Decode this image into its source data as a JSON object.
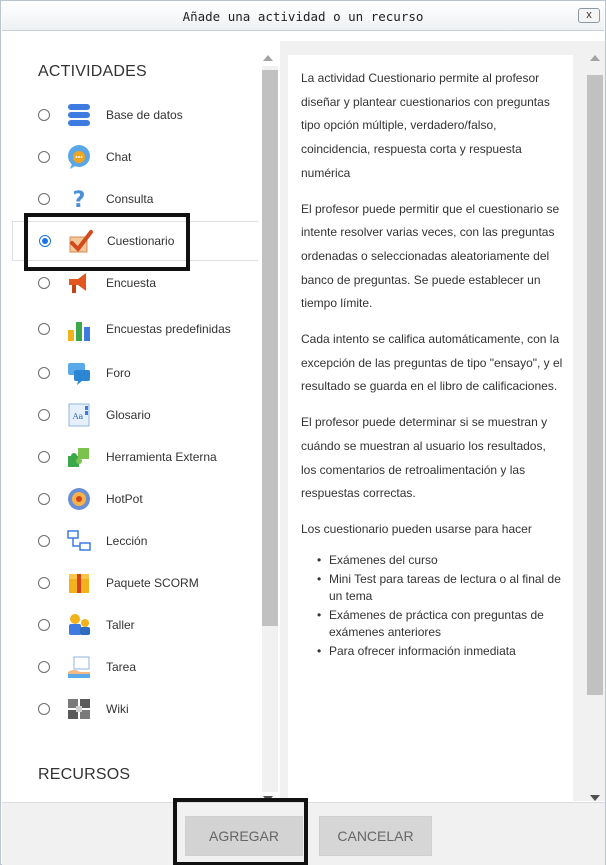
{
  "dialog": {
    "title": "Añade una actividad o un recurso",
    "close_label": "x"
  },
  "sections": {
    "activities": "ACTIVIDADES",
    "resources": "RECURSOS"
  },
  "activities": [
    {
      "label": "Base de datos",
      "icon": "database-icon",
      "selected": false
    },
    {
      "label": "Chat",
      "icon": "chat-icon",
      "selected": false
    },
    {
      "label": "Consulta",
      "icon": "question-icon",
      "selected": false
    },
    {
      "label": "Cuestionario",
      "icon": "quiz-checkmark-icon",
      "selected": true
    },
    {
      "label": "Encuesta",
      "icon": "megaphone-icon",
      "selected": false
    },
    {
      "label": "Encuestas predefinidas",
      "icon": "bar-chart-icon",
      "selected": false
    },
    {
      "label": "Foro",
      "icon": "forum-icon",
      "selected": false
    },
    {
      "label": "Glosario",
      "icon": "glossary-icon",
      "selected": false
    },
    {
      "label": "Herramienta Externa",
      "icon": "puzzle-icon",
      "selected": false
    },
    {
      "label": "HotPot",
      "icon": "hotpot-icon",
      "selected": false
    },
    {
      "label": "Lección",
      "icon": "lesson-icon",
      "selected": false
    },
    {
      "label": "Paquete SCORM",
      "icon": "package-icon",
      "selected": false
    },
    {
      "label": "Taller",
      "icon": "workshop-icon",
      "selected": false
    },
    {
      "label": "Tarea",
      "icon": "assignment-icon",
      "selected": false
    },
    {
      "label": "Wiki",
      "icon": "wiki-icon",
      "selected": false
    }
  ],
  "description": {
    "paragraphs": [
      "La actividad Cuestionario permite al profesor diseñar y plantear cuestionarios con preguntas tipo opción múltiple, verdadero/falso, coincidencia, respuesta corta y respuesta numérica",
      "El profesor puede permitir que el cuestionario se intente resolver varias veces, con las preguntas ordenadas o seleccionadas aleatoriamente del banco de preguntas. Se puede establecer un tiempo límite.",
      "Cada intento se califica automáticamente, con la excepción de las preguntas de tipo \"ensayo\", y el resultado se guarda en el libro de calificaciones.",
      "El profesor puede determinar si se muestran y cuándo se muestran al usuario los resultados, los comentarios de retroalimentación y las respuestas correctas.",
      "Los cuestionario pueden usarse para hacer"
    ],
    "bullets": [
      "Exámenes del curso",
      "Mini Test para tareas de lectura o al final de un tema",
      "Exámenes de práctica con preguntas de exámenes anteriores",
      "Para ofrecer información inmediata"
    ]
  },
  "footer": {
    "add_label": "AGREGAR",
    "cancel_label": "CANCELAR"
  },
  "colors": {
    "radio_selected": "#1a73e8",
    "highlight_box": "#111111",
    "panel_gray": "#f1f1f1"
  }
}
